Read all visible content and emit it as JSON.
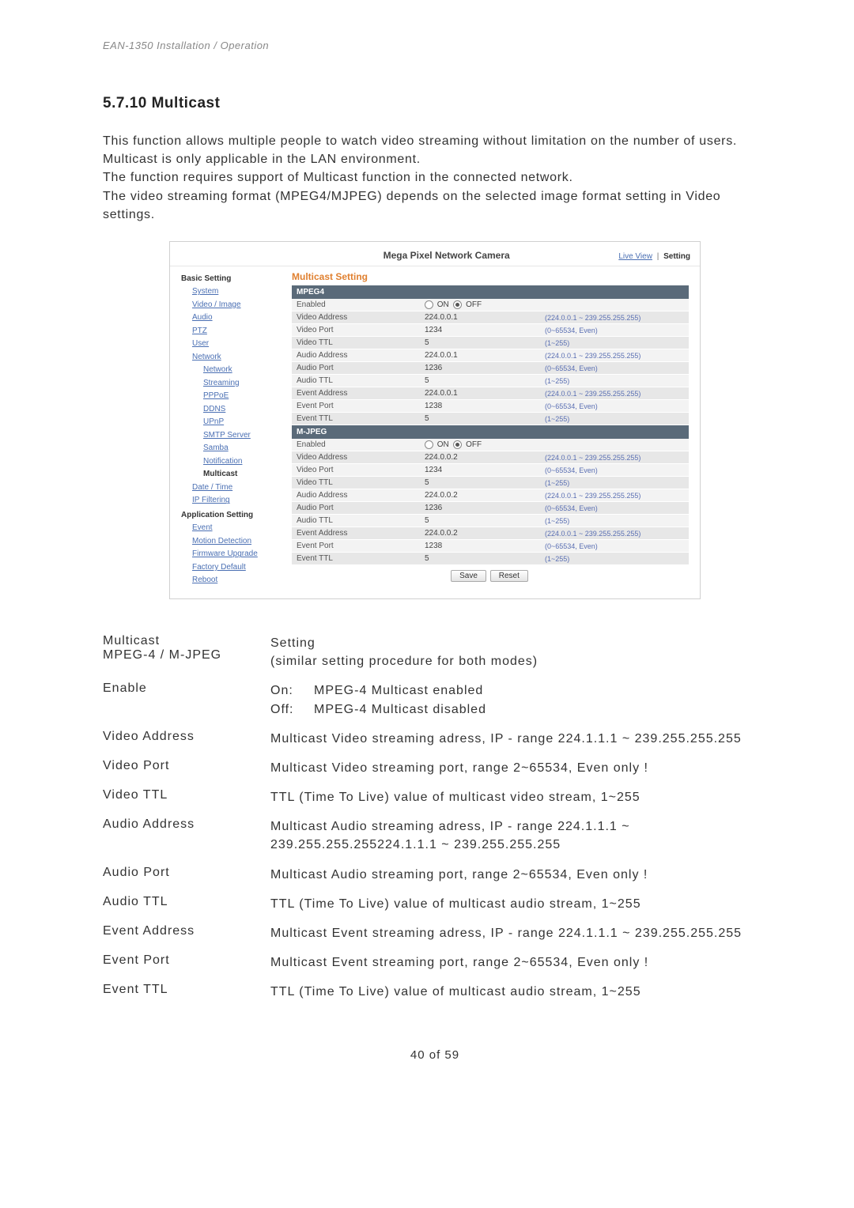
{
  "header": "EAN-1350   Installation / Operation",
  "section_number": "5.7.10",
  "section_title": "Multicast",
  "intro": "This function allows multiple people to watch video streaming without limitation on the number of users. Multicast is only applicable in the LAN environment.\nThe function requires support of Multicast function in the connected network.\nThe video streaming format (MPEG4/MJPEG) depends on the selected image format setting in Video settings.",
  "panel": {
    "title": "Mega Pixel Network Camera",
    "links": {
      "live": "Live View",
      "setting": "Setting"
    },
    "sidebar": {
      "basic": "Basic Setting",
      "system": "System",
      "video": "Video / Image",
      "audio": "Audio",
      "ptz": "PTZ",
      "user": "User",
      "network": "Network",
      "network_sub": "Network",
      "streaming": "Streaming",
      "pppoe": "PPPoE",
      "ddns": "DDNS",
      "upnp": "UPnP",
      "smtp": "SMTP Server",
      "samba": "Samba",
      "notification": "Notification",
      "multicast": "Multicast",
      "datetime": "Date / Time",
      "ipfilter": "IP Filtering",
      "app": "Application Setting",
      "event": "Event",
      "motion": "Motion Detection",
      "firmware": "Firmware Upgrade",
      "factory": "Factory Default",
      "reboot": "Reboot"
    },
    "content_title": "Multicast Setting",
    "groups": [
      {
        "head": "MPEG4",
        "rows": [
          {
            "label": "Enabled",
            "val_radio": true,
            "on": "ON",
            "off": "OFF",
            "hint": ""
          },
          {
            "label": "Video Address",
            "val": "224.0.0.1",
            "hint": "(224.0.0.1 ~ 239.255.255.255)"
          },
          {
            "label": "Video Port",
            "val": "1234",
            "hint": "(0~65534, Even)"
          },
          {
            "label": "Video TTL",
            "val": "5",
            "hint": "(1~255)"
          },
          {
            "label": "Audio Address",
            "val": "224.0.0.1",
            "hint": "(224.0.0.1 ~ 239.255.255.255)"
          },
          {
            "label": "Audio Port",
            "val": "1236",
            "hint": "(0~65534, Even)"
          },
          {
            "label": "Audio TTL",
            "val": "5",
            "hint": "(1~255)"
          },
          {
            "label": "Event Address",
            "val": "224.0.0.1",
            "hint": "(224.0.0.1 ~ 239.255.255.255)"
          },
          {
            "label": "Event Port",
            "val": "1238",
            "hint": "(0~65534, Even)"
          },
          {
            "label": "Event TTL",
            "val": "5",
            "hint": "(1~255)"
          }
        ]
      },
      {
        "head": "M-JPEG",
        "rows": [
          {
            "label": "Enabled",
            "val_radio": true,
            "on": "ON",
            "off": "OFF",
            "hint": ""
          },
          {
            "label": "Video Address",
            "val": "224.0.0.2",
            "hint": "(224.0.0.1 ~ 239.255.255.255)"
          },
          {
            "label": "Video Port",
            "val": "1234",
            "hint": "(0~65534, Even)"
          },
          {
            "label": "Video TTL",
            "val": "5",
            "hint": "(1~255)"
          },
          {
            "label": "Audio Address",
            "val": "224.0.0.2",
            "hint": "(224.0.0.1 ~ 239.255.255.255)"
          },
          {
            "label": "Audio Port",
            "val": "1236",
            "hint": "(0~65534, Even)"
          },
          {
            "label": "Audio TTL",
            "val": "5",
            "hint": "(1~255)"
          },
          {
            "label": "Event Address",
            "val": "224.0.0.2",
            "hint": "(224.0.0.1 ~ 239.255.255.255)"
          },
          {
            "label": "Event Port",
            "val": "1238",
            "hint": "(0~65534, Even)"
          },
          {
            "label": "Event TTL",
            "val": "5",
            "hint": "(1~255)"
          }
        ]
      }
    ],
    "buttons": {
      "save": "Save",
      "reset": "Reset"
    }
  },
  "defs": [
    {
      "term": "Multicast\nMPEG-4 / M-JPEG",
      "desc": "Setting\n(similar setting procedure for both modes)"
    },
    {
      "term": "Enable",
      "desc_onoff": {
        "on_k": "On:",
        "on_v": "MPEG-4 Multicast enabled",
        "off_k": "Off:",
        "off_v": "MPEG-4  Multicast disabled"
      }
    },
    {
      "term": "Video Address",
      "desc": "Multicast Video streaming adress, IP - range 224.1.1.1 ~ 239.255.255.255"
    },
    {
      "term": "Video Port",
      "desc": "Multicast Video streaming port, range 2~65534, Even only !"
    },
    {
      "term": "Video TTL",
      "desc": "TTL (Time To Live) value of multicast video stream, 1~255"
    },
    {
      "term": "Audio Address",
      "desc": "Multicast Audio streaming adress, IP - range 224.1.1.1 ~ 239.255.255.255224.1.1.1 ~ 239.255.255.255"
    },
    {
      "term": "Audio Port",
      "desc": "Multicast Audio streaming port, range 2~65534, Even only !"
    },
    {
      "term": "Audio TTL",
      "desc": "TTL (Time To Live) value of multicast audio stream, 1~255"
    },
    {
      "term": "Event Address",
      "desc": "Multicast Event streaming adress, IP - range 224.1.1.1 ~ 239.255.255.255"
    },
    {
      "term": "Event Port",
      "desc": "Multicast Event streaming port, range 2~65534, Even only !"
    },
    {
      "term": "Event TTL",
      "desc": "TTL (Time To Live) value of multicast audio stream, 1~255"
    }
  ],
  "footer": "40 of 59"
}
